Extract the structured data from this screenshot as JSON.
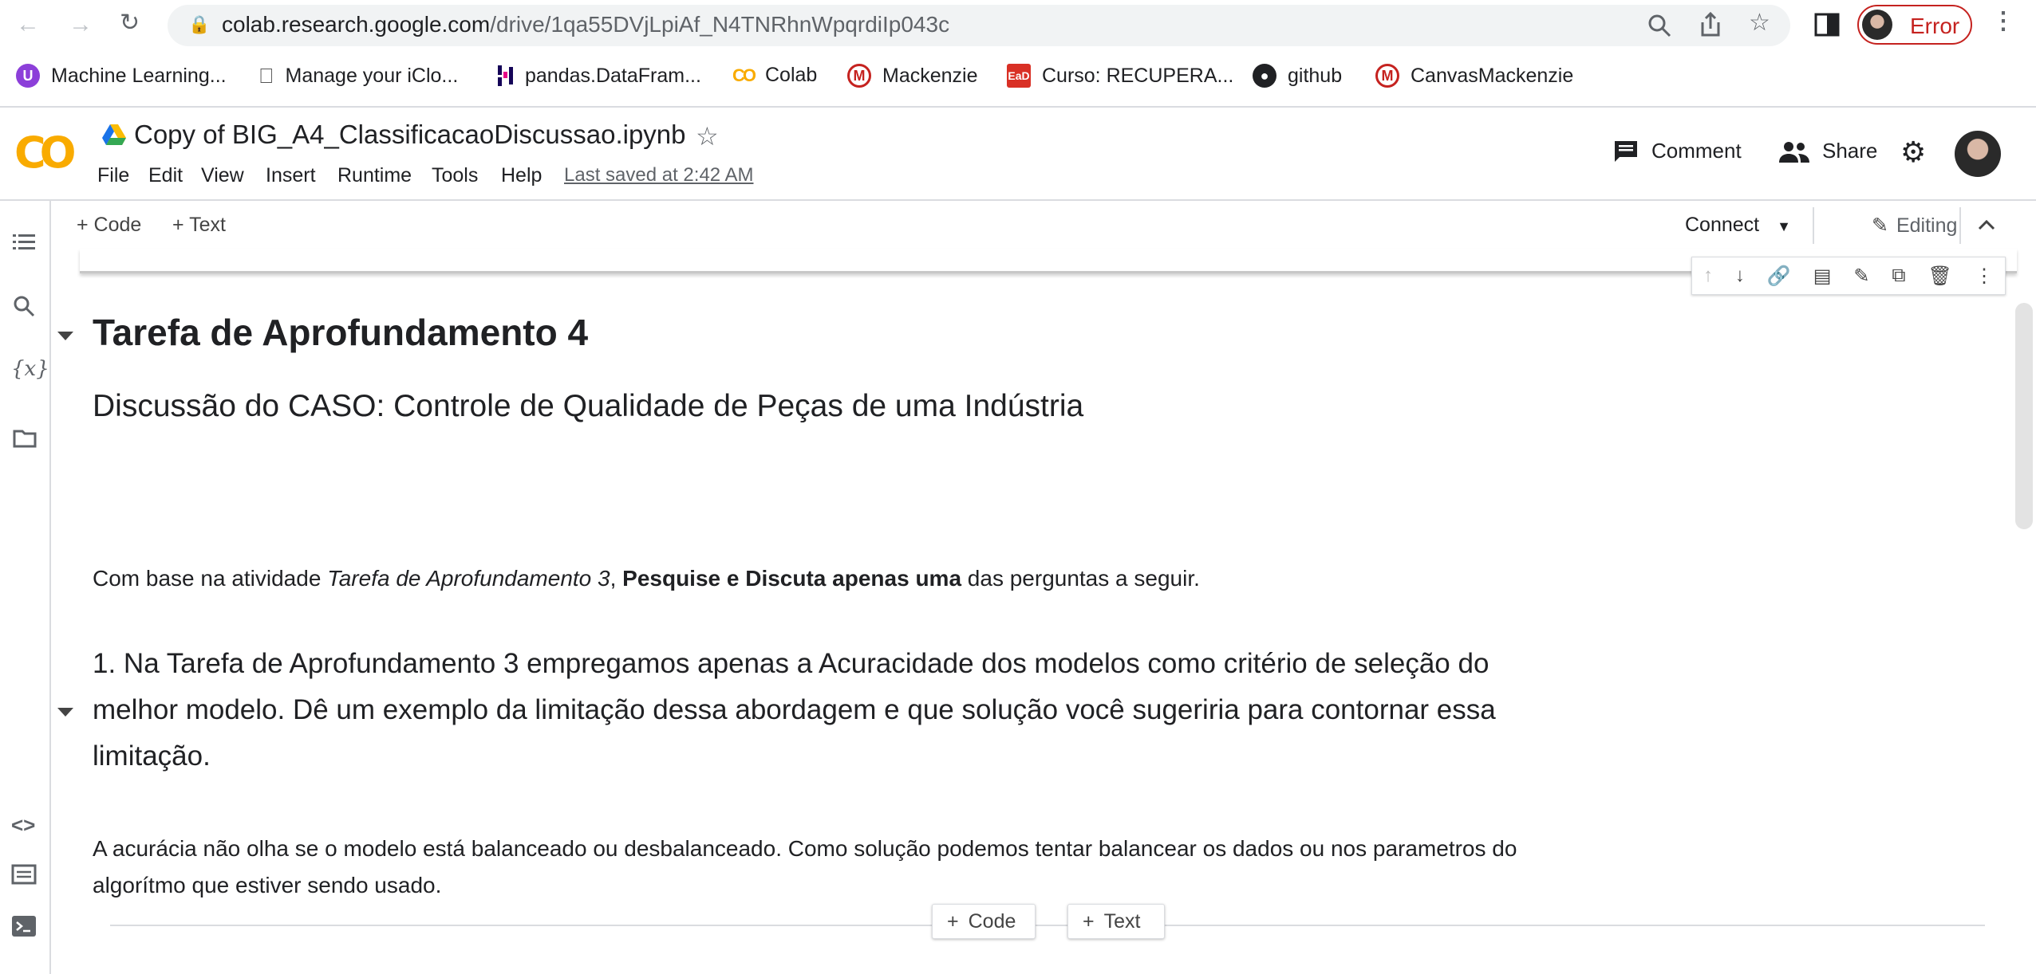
{
  "browser": {
    "url_host": "colab.research.google.com",
    "url_path": "/drive/1qa55DVjLpiAf_N4TNRhnWpqrdiIp043c",
    "error_label": "Error"
  },
  "bookmarks": [
    {
      "label": "Machine Learning...",
      "icon": "U"
    },
    {
      "label": "Manage your iClo...",
      "icon": ""
    },
    {
      "label": "pandas.DataFram...",
      "icon": ""
    },
    {
      "label": "Colab",
      "icon": "CO"
    },
    {
      "label": "Mackenzie",
      "icon": "M"
    },
    {
      "label": "Curso: RECUPERA...",
      "icon": "EaD"
    },
    {
      "label": "github",
      "icon": ""
    },
    {
      "label": "CanvasMackenzie",
      "icon": "M"
    }
  ],
  "colab": {
    "logo": "CO",
    "doc_title": "Copy of BIG_A4_ClassificacaoDiscussao.ipynb",
    "menu": [
      "File",
      "Edit",
      "View",
      "Insert",
      "Runtime",
      "Tools",
      "Help"
    ],
    "last_saved": "Last saved at 2:42 AM",
    "comment_label": "Comment",
    "share_label": "Share"
  },
  "toolbar": {
    "code_label": "Code",
    "text_label": "Text",
    "connect_label": "Connect",
    "editing_label": "Editing"
  },
  "notebook": {
    "heading": "Tarefa de Aprofundamento 4",
    "subheading": "Discussão do CASO: Controle de Qualidade de Peças de uma Indústria",
    "intro_prefix": "Com base na atividade ",
    "intro_italic": "Tarefa de Aprofundamento 3",
    "intro_sep": ", ",
    "intro_bold": "Pesquise e Discuta apenas uma",
    "intro_suffix": " das perguntas a seguir.",
    "question": "1. Na Tarefa de Aprofundamento 3 empregamos apenas a Acuracidade dos modelos como critério de seleção do melhor modelo. Dê um exemplo da limitação dessa abordagem e que solução você sugeriria para contornar essa limitação.",
    "answer": "A acurácia não olha se o modelo está balanceado ou desbalanceado. Como solução podemos tentar balancear os dados ou nos parametros do algorítmo que estiver sendo usado.",
    "add_code_label": "Code",
    "add_text_label": "Text"
  }
}
